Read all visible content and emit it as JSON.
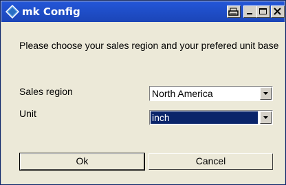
{
  "window": {
    "title": "mk Config"
  },
  "titlebar_buttons": [
    "printer-icon",
    "minimize-icon",
    "maximize-icon",
    "close-icon"
  ],
  "form": {
    "instructions": "Please choose your sales region and your prefered unit base",
    "sales_region": {
      "label": "Sales region",
      "value": "North America"
    },
    "unit": {
      "label": "Unit",
      "value": "inch"
    }
  },
  "buttons": {
    "ok": "Ok",
    "cancel": "Cancel"
  },
  "colors": {
    "titlebar": "#1b45b7",
    "selection": "#0a246a",
    "dialog_bg": "#ece9d8"
  }
}
